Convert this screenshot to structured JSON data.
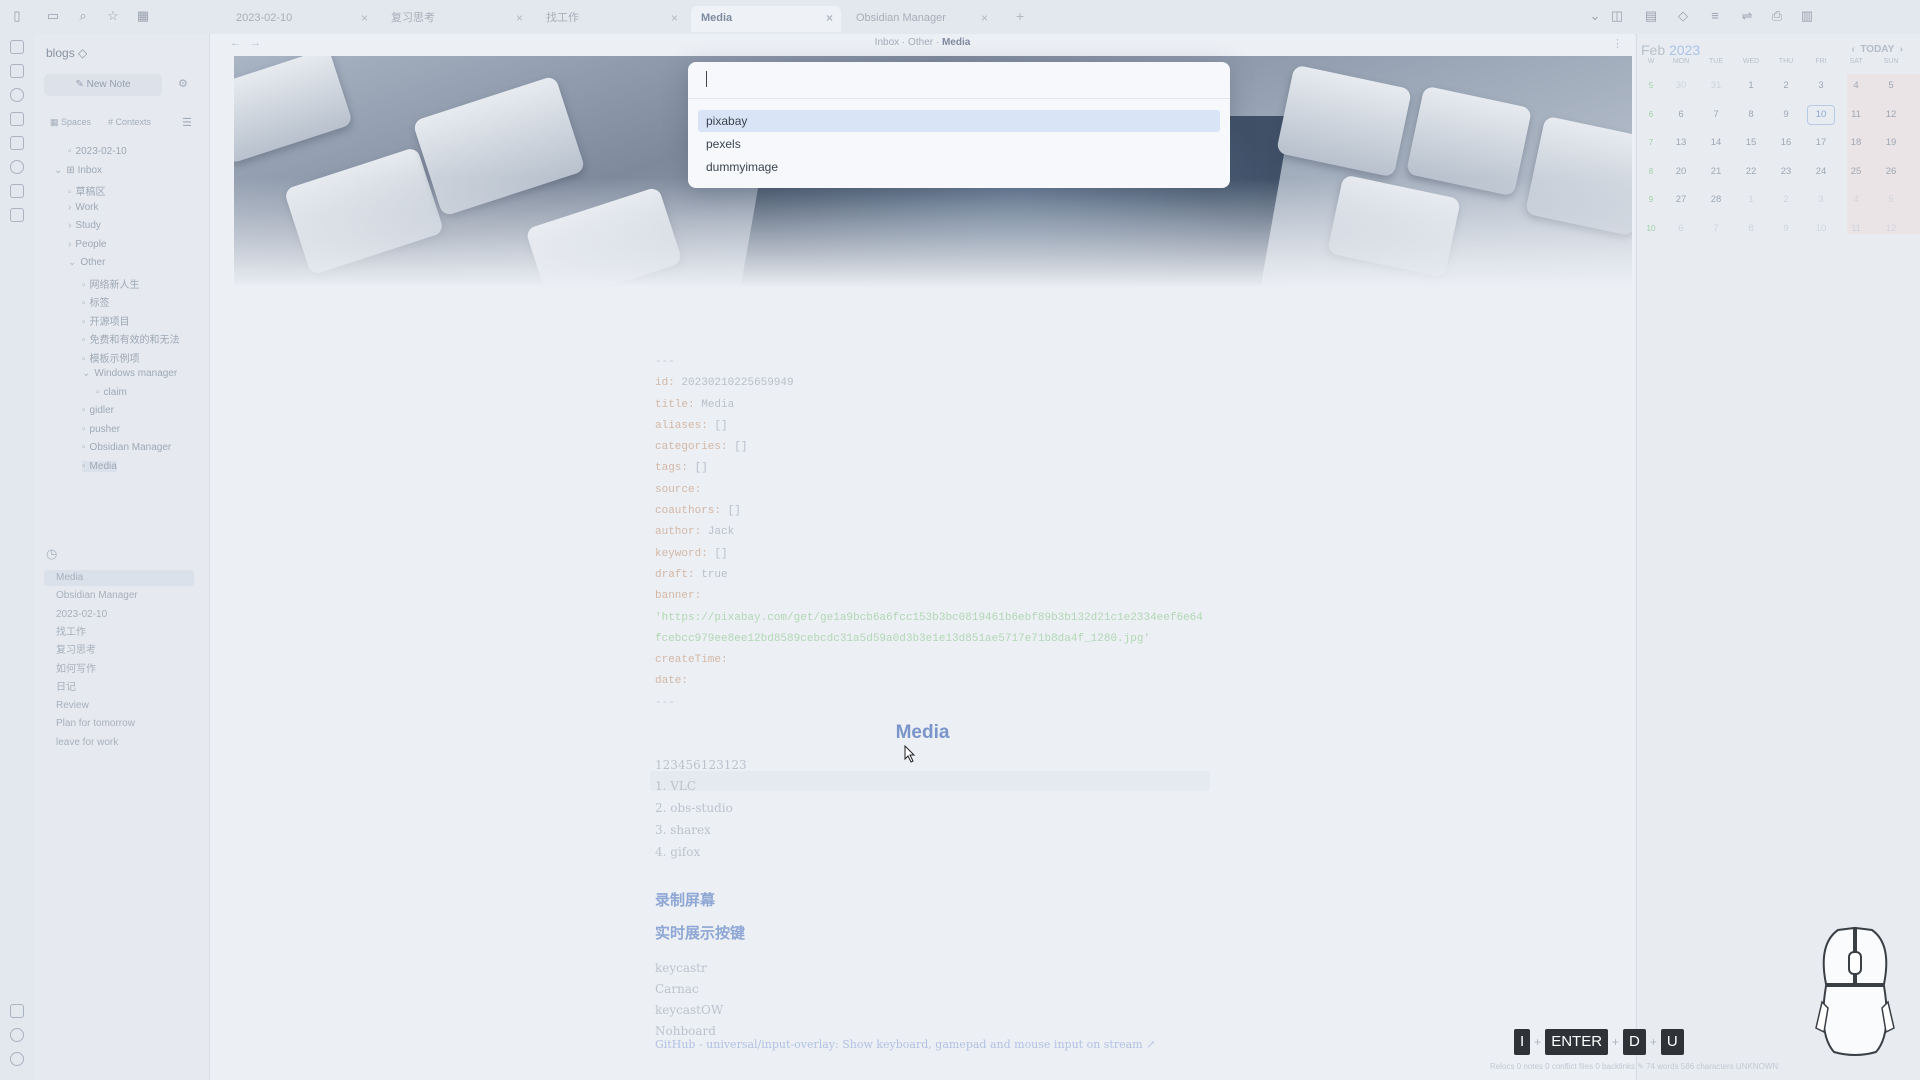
{
  "tabs": [
    {
      "label": "2023-02-10"
    },
    {
      "label": "复习思考"
    },
    {
      "label": "找工作"
    },
    {
      "label": "Media",
      "active": true
    },
    {
      "label": "Obsidian Manager"
    }
  ],
  "breadcrumb": {
    "part1": "Inbox",
    "sep": "·",
    "part2": "Other",
    "current": "Media"
  },
  "sidebar": {
    "vault_name": "blogs ◇",
    "new_note": "New Note",
    "spaces_label": "Spaces",
    "contexts_label": "Contexts",
    "tree": [
      {
        "label": "2023-02-10",
        "indent": 1
      },
      {
        "label": "Inbox",
        "indent": 0,
        "prefix": "⊞",
        "expanded": true
      },
      {
        "label": "草稿区",
        "indent": 1
      },
      {
        "label": "Work",
        "indent": 1,
        "collapsed": true
      },
      {
        "label": "Study",
        "indent": 1,
        "collapsed": true
      },
      {
        "label": "People",
        "indent": 1,
        "collapsed": true
      },
      {
        "label": "Other",
        "indent": 1,
        "expanded": true
      },
      {
        "label": "网络新人生",
        "indent": 2
      },
      {
        "label": "标签",
        "indent": 2
      },
      {
        "label": "开源项目",
        "indent": 2
      },
      {
        "label": "免费和有效的和无法",
        "indent": 2
      },
      {
        "label": "模板示例项",
        "indent": 2
      },
      {
        "label": "Windows manager",
        "indent": 2,
        "expanded": true
      },
      {
        "label": "claim",
        "indent": 3
      },
      {
        "label": "gidler",
        "indent": 2
      },
      {
        "label": "pusher",
        "indent": 2
      },
      {
        "label": "Obsidian Manager",
        "indent": 2
      },
      {
        "label": "Media",
        "indent": 2,
        "selected": true
      }
    ],
    "recent": [
      {
        "label": "Media",
        "selected": true
      },
      {
        "label": "Obsidian Manager"
      },
      {
        "label": "2023-02-10"
      },
      {
        "label": "找工作"
      },
      {
        "label": "复习思考"
      },
      {
        "label": "如何写作"
      },
      {
        "label": "日记"
      },
      {
        "label": "Review"
      },
      {
        "label": "Plan for tomorrow"
      },
      {
        "label": "leave for work"
      }
    ]
  },
  "editor": {
    "frontmatter": [
      {
        "text": "---"
      },
      {
        "key": "id:",
        "val": " 20230210225659949"
      },
      {
        "key": "title:",
        "val": " Media"
      },
      {
        "key": "aliases:",
        "val": " []"
      },
      {
        "key": "categories:",
        "val": " []"
      },
      {
        "key": "tags:",
        "val": " []"
      },
      {
        "key": "source:",
        "val": ""
      },
      {
        "key": "coauthors:",
        "val": " []"
      },
      {
        "key": "author:",
        "val": " Jack"
      },
      {
        "key": "keyword:",
        "val": " []"
      },
      {
        "key": "draft:",
        "val": " true"
      },
      {
        "key": "banner:",
        "val": ""
      },
      {
        "url": "'https://pixabay.com/get/ge1a9bcb6a6fcc153b3bc0819461b6ebf89b3b132d21c1e2334eef6e64"
      },
      {
        "url": "fcebcc979ee8ee12bd8589cebcdc31a5d59a0d3b3e1e13d851ae5717e71b8da4f_1280.jpg'"
      },
      {
        "key": "createTime:",
        "val": ""
      },
      {
        "key": "date:",
        "val": ""
      },
      {
        "text": "---"
      }
    ],
    "heading": "Media",
    "paragraph": "123456123123",
    "list": [
      "1. VLC",
      "2. obs-studio",
      "3. sharex",
      "4. gifox"
    ],
    "h2a": "录制屏幕",
    "h2b": "实时展示按键",
    "tools": [
      "keycastr",
      "Carnac",
      "keycastOW",
      "Nohboard"
    ],
    "link": "GitHub - universal/input-overlay: Show keyboard, gamepad and mouse input on stream ↗"
  },
  "switcher": {
    "input_value": "",
    "suggestions": [
      "pixabay",
      "pexels",
      "dummyimage"
    ],
    "selected_index": 0
  },
  "calendar": {
    "month": "Feb",
    "year": "2023",
    "today_label": "TODAY",
    "prev": "‹",
    "next": "›",
    "headers": [
      "W",
      "MON",
      "TUE",
      "WED",
      "THU",
      "FRI",
      "SAT",
      "SUN"
    ],
    "weeks": [
      [
        "5",
        "30",
        "31",
        "1",
        "2",
        "3",
        "4",
        "5"
      ],
      [
        "6",
        "6",
        "7",
        "8",
        "9",
        "10",
        "11",
        "12"
      ],
      [
        "7",
        "13",
        "14",
        "15",
        "16",
        "17",
        "18",
        "19"
      ],
      [
        "8",
        "20",
        "21",
        "22",
        "23",
        "24",
        "25",
        "26"
      ],
      [
        "9",
        "27",
        "28",
        "1",
        "2",
        "3",
        "4",
        "5"
      ],
      [
        "10",
        "6",
        "7",
        "8",
        "9",
        "10",
        "11",
        "12"
      ]
    ],
    "today": "10"
  },
  "statusbar": "Relocs 0 notes  0 conflict files  0 backlinks  ✎  74 words  586 characters   UNKNOWN",
  "keystrokes": [
    "I",
    "ENTER",
    "D",
    "U"
  ],
  "keystroke_sep": "+",
  "colors": {
    "accent": "#7a95c9",
    "selection": "#d9e5f6"
  }
}
